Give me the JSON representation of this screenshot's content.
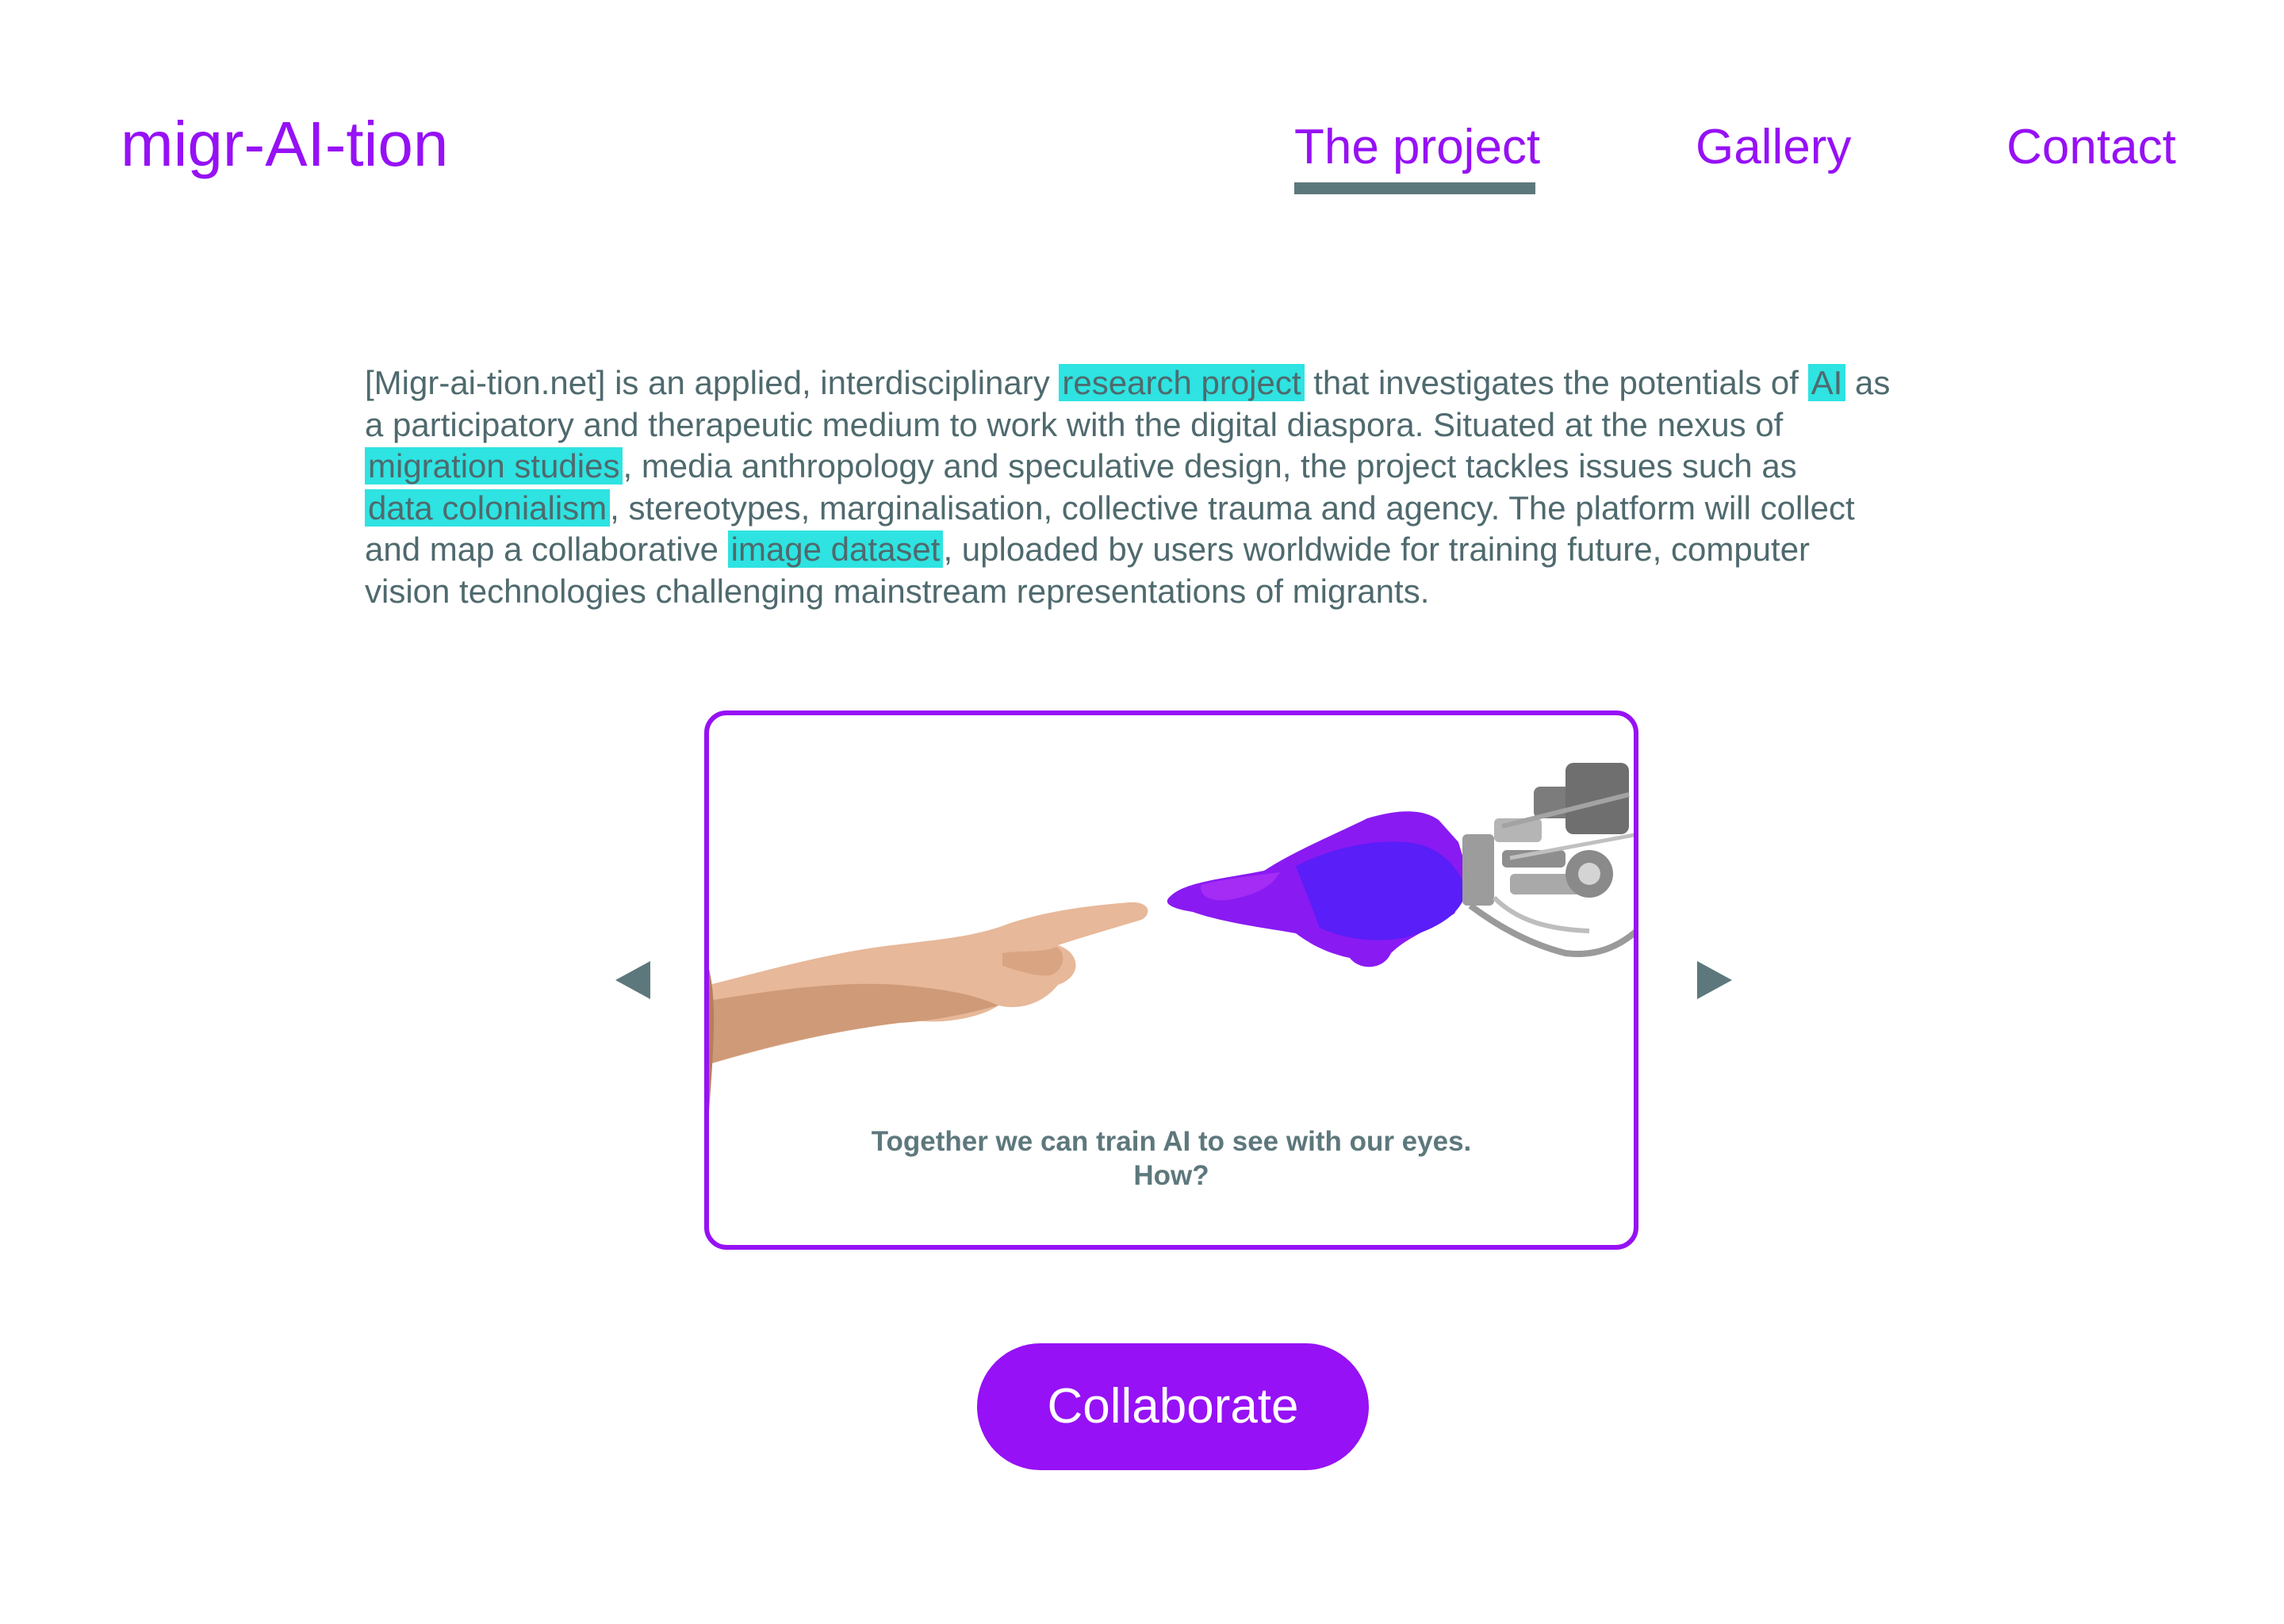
{
  "header": {
    "brand": "migr-AI-tion",
    "nav": [
      {
        "label": "The project",
        "active": true
      },
      {
        "label": "Gallery",
        "active": false
      },
      {
        "label": "Contact",
        "active": false
      }
    ]
  },
  "intro": {
    "lines": [
      [
        "[Migr-ai-tion.net] is an applied, interdisciplinary ",
        "research project",
        " that investigates the potentials of ",
        "AI",
        " as"
      ],
      [
        "a participatory and therapeutic medium to work with the digital diaspora. Situated at the nexus of"
      ],
      [
        "",
        "migration studies",
        ", media anthropology and speculative design, the project tackles issues such as"
      ],
      [
        "",
        "data colonialism",
        ", stereotypes, marginalisation, collective trauma and agency. The platform will collect"
      ],
      [
        "and map a collaborative ",
        "image dataset",
        ", uploaded by users worldwide for training future, computer"
      ],
      [
        "vision technologies challenging mainstream representations of migrants."
      ]
    ],
    "highlighted_terms": [
      "research project",
      "AI",
      "migration studies",
      "data colonialism",
      "image dataset"
    ]
  },
  "carousel": {
    "image_description_icon": "human-and-robot-hands-icon",
    "caption_line1": "Together we can train AI to see with our eyes.",
    "caption_line2": "How?"
  },
  "cta": {
    "label": "Collaborate"
  },
  "colors": {
    "accent": "#9611f5",
    "text": "#4f6a6e",
    "muted": "#5d787c",
    "highlight": "#2ee3e1",
    "background": "#ffffff"
  }
}
